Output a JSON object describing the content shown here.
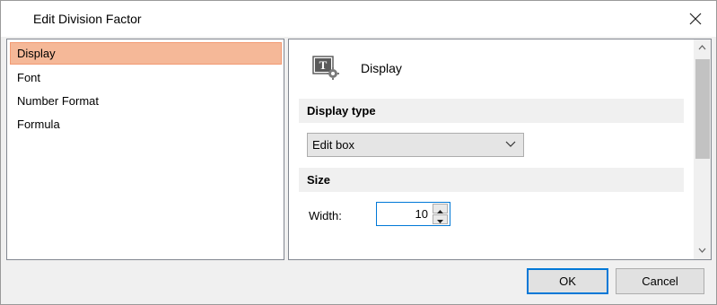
{
  "window": {
    "title": "Edit Division Factor"
  },
  "nav": {
    "items": [
      {
        "label": "Display",
        "selected": true
      },
      {
        "label": "Font",
        "selected": false
      },
      {
        "label": "Number Format",
        "selected": false
      },
      {
        "label": "Formula",
        "selected": false
      }
    ]
  },
  "panel": {
    "title": "Display",
    "icon": "display-settings-icon",
    "sections": {
      "display_type": {
        "title": "Display type",
        "select_value": "Edit box"
      },
      "size": {
        "title": "Size",
        "width_label": "Width:",
        "width_value": "10"
      }
    }
  },
  "buttons": {
    "ok": "OK",
    "cancel": "Cancel"
  },
  "colors": {
    "selection": "#f5b898",
    "accent": "#0078d7"
  }
}
